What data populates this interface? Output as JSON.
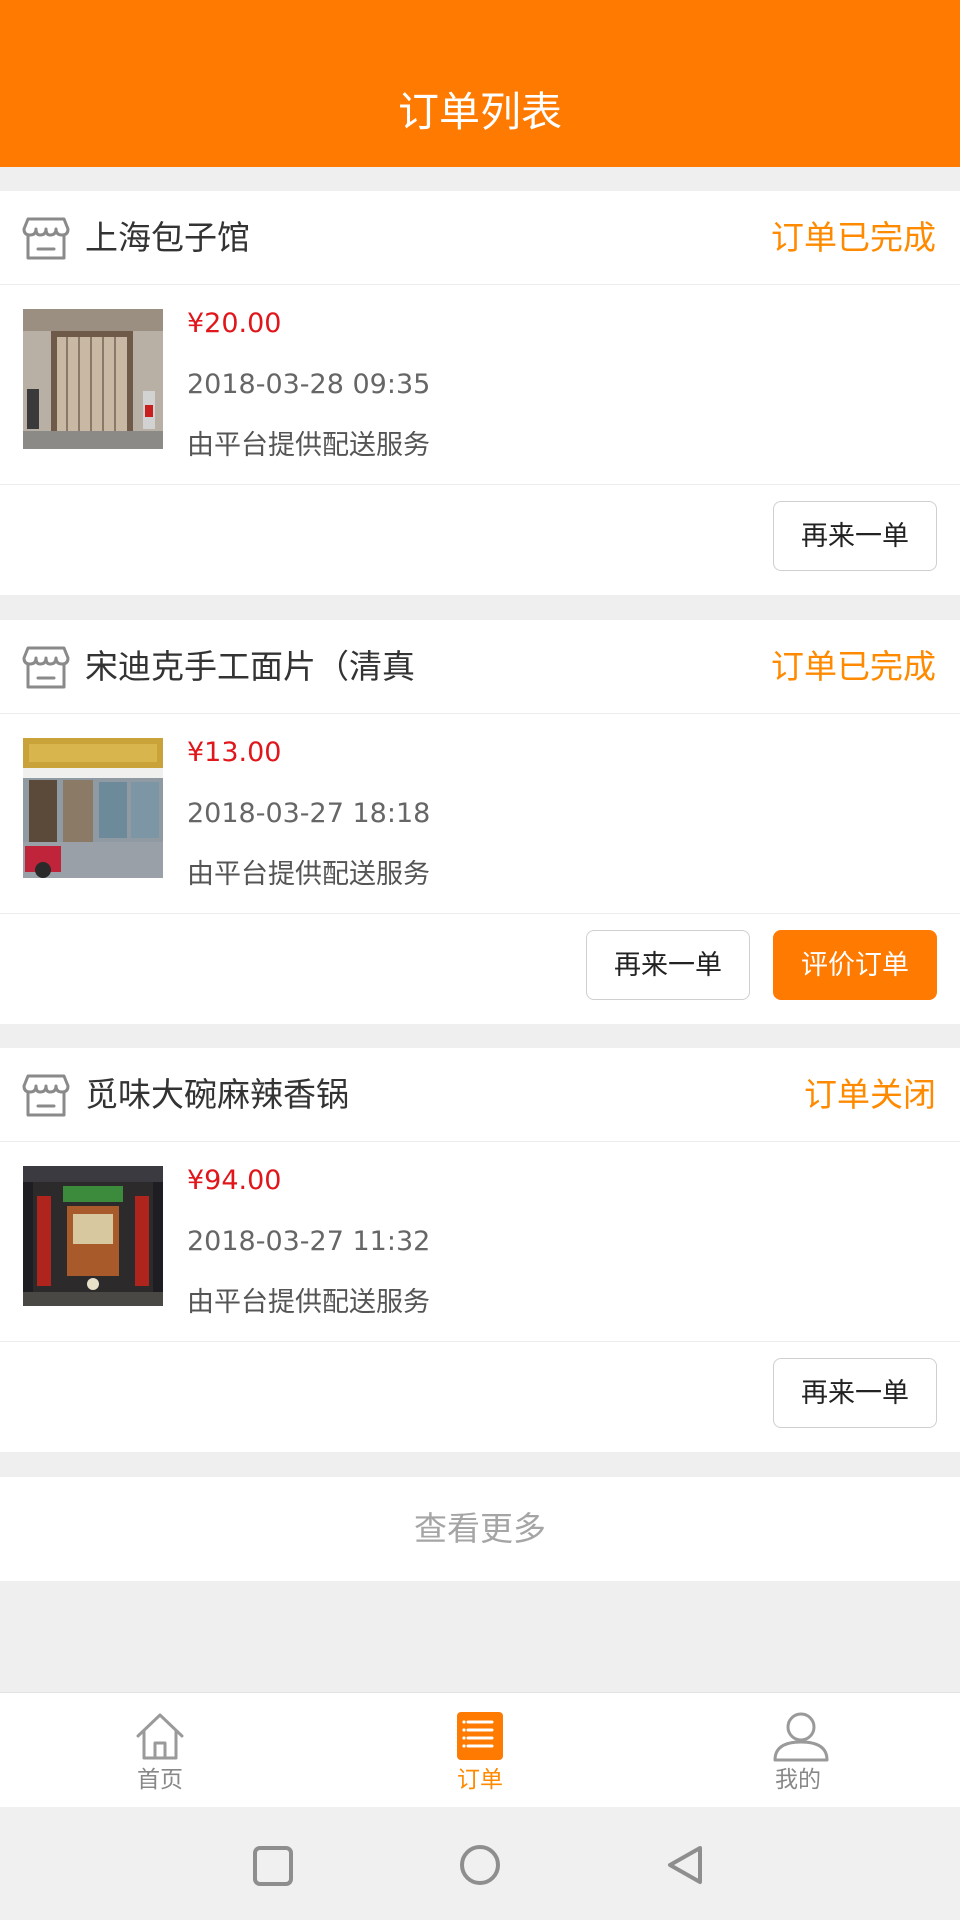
{
  "header": {
    "title": "订单列表"
  },
  "colors": {
    "accent": "#ff7a00",
    "status": "#ff8a00",
    "price": "#e0161b"
  },
  "orders": [
    {
      "shop_name": "上海包子馆",
      "status": "订单已完成",
      "price": "¥20.00",
      "date": "2018-03-28 09:35",
      "delivery": "由平台提供配送服务",
      "buttons": {
        "reorder": "再来一单"
      }
    },
    {
      "shop_name": "宋迪克手工面片（清真",
      "status": "订单已完成",
      "price": "¥13.00",
      "date": "2018-03-27 18:18",
      "delivery": "由平台提供配送服务",
      "buttons": {
        "reorder": "再来一单",
        "review": "评价订单"
      }
    },
    {
      "shop_name": "觅味大碗麻辣香锅",
      "status": "订单关闭",
      "price": "¥94.00",
      "date": "2018-03-27 11:32",
      "delivery": "由平台提供配送服务",
      "buttons": {
        "reorder": "再来一单"
      }
    }
  ],
  "load_more": "查看更多",
  "tabbar": {
    "items": [
      {
        "label": "首页",
        "icon": "home-icon"
      },
      {
        "label": "订单",
        "icon": "order-list-icon",
        "active": true
      },
      {
        "label": "我的",
        "icon": "user-icon"
      }
    ]
  },
  "system_nav": {
    "icons": [
      "square-recent-icon",
      "circle-home-icon",
      "triangle-back-icon"
    ]
  }
}
